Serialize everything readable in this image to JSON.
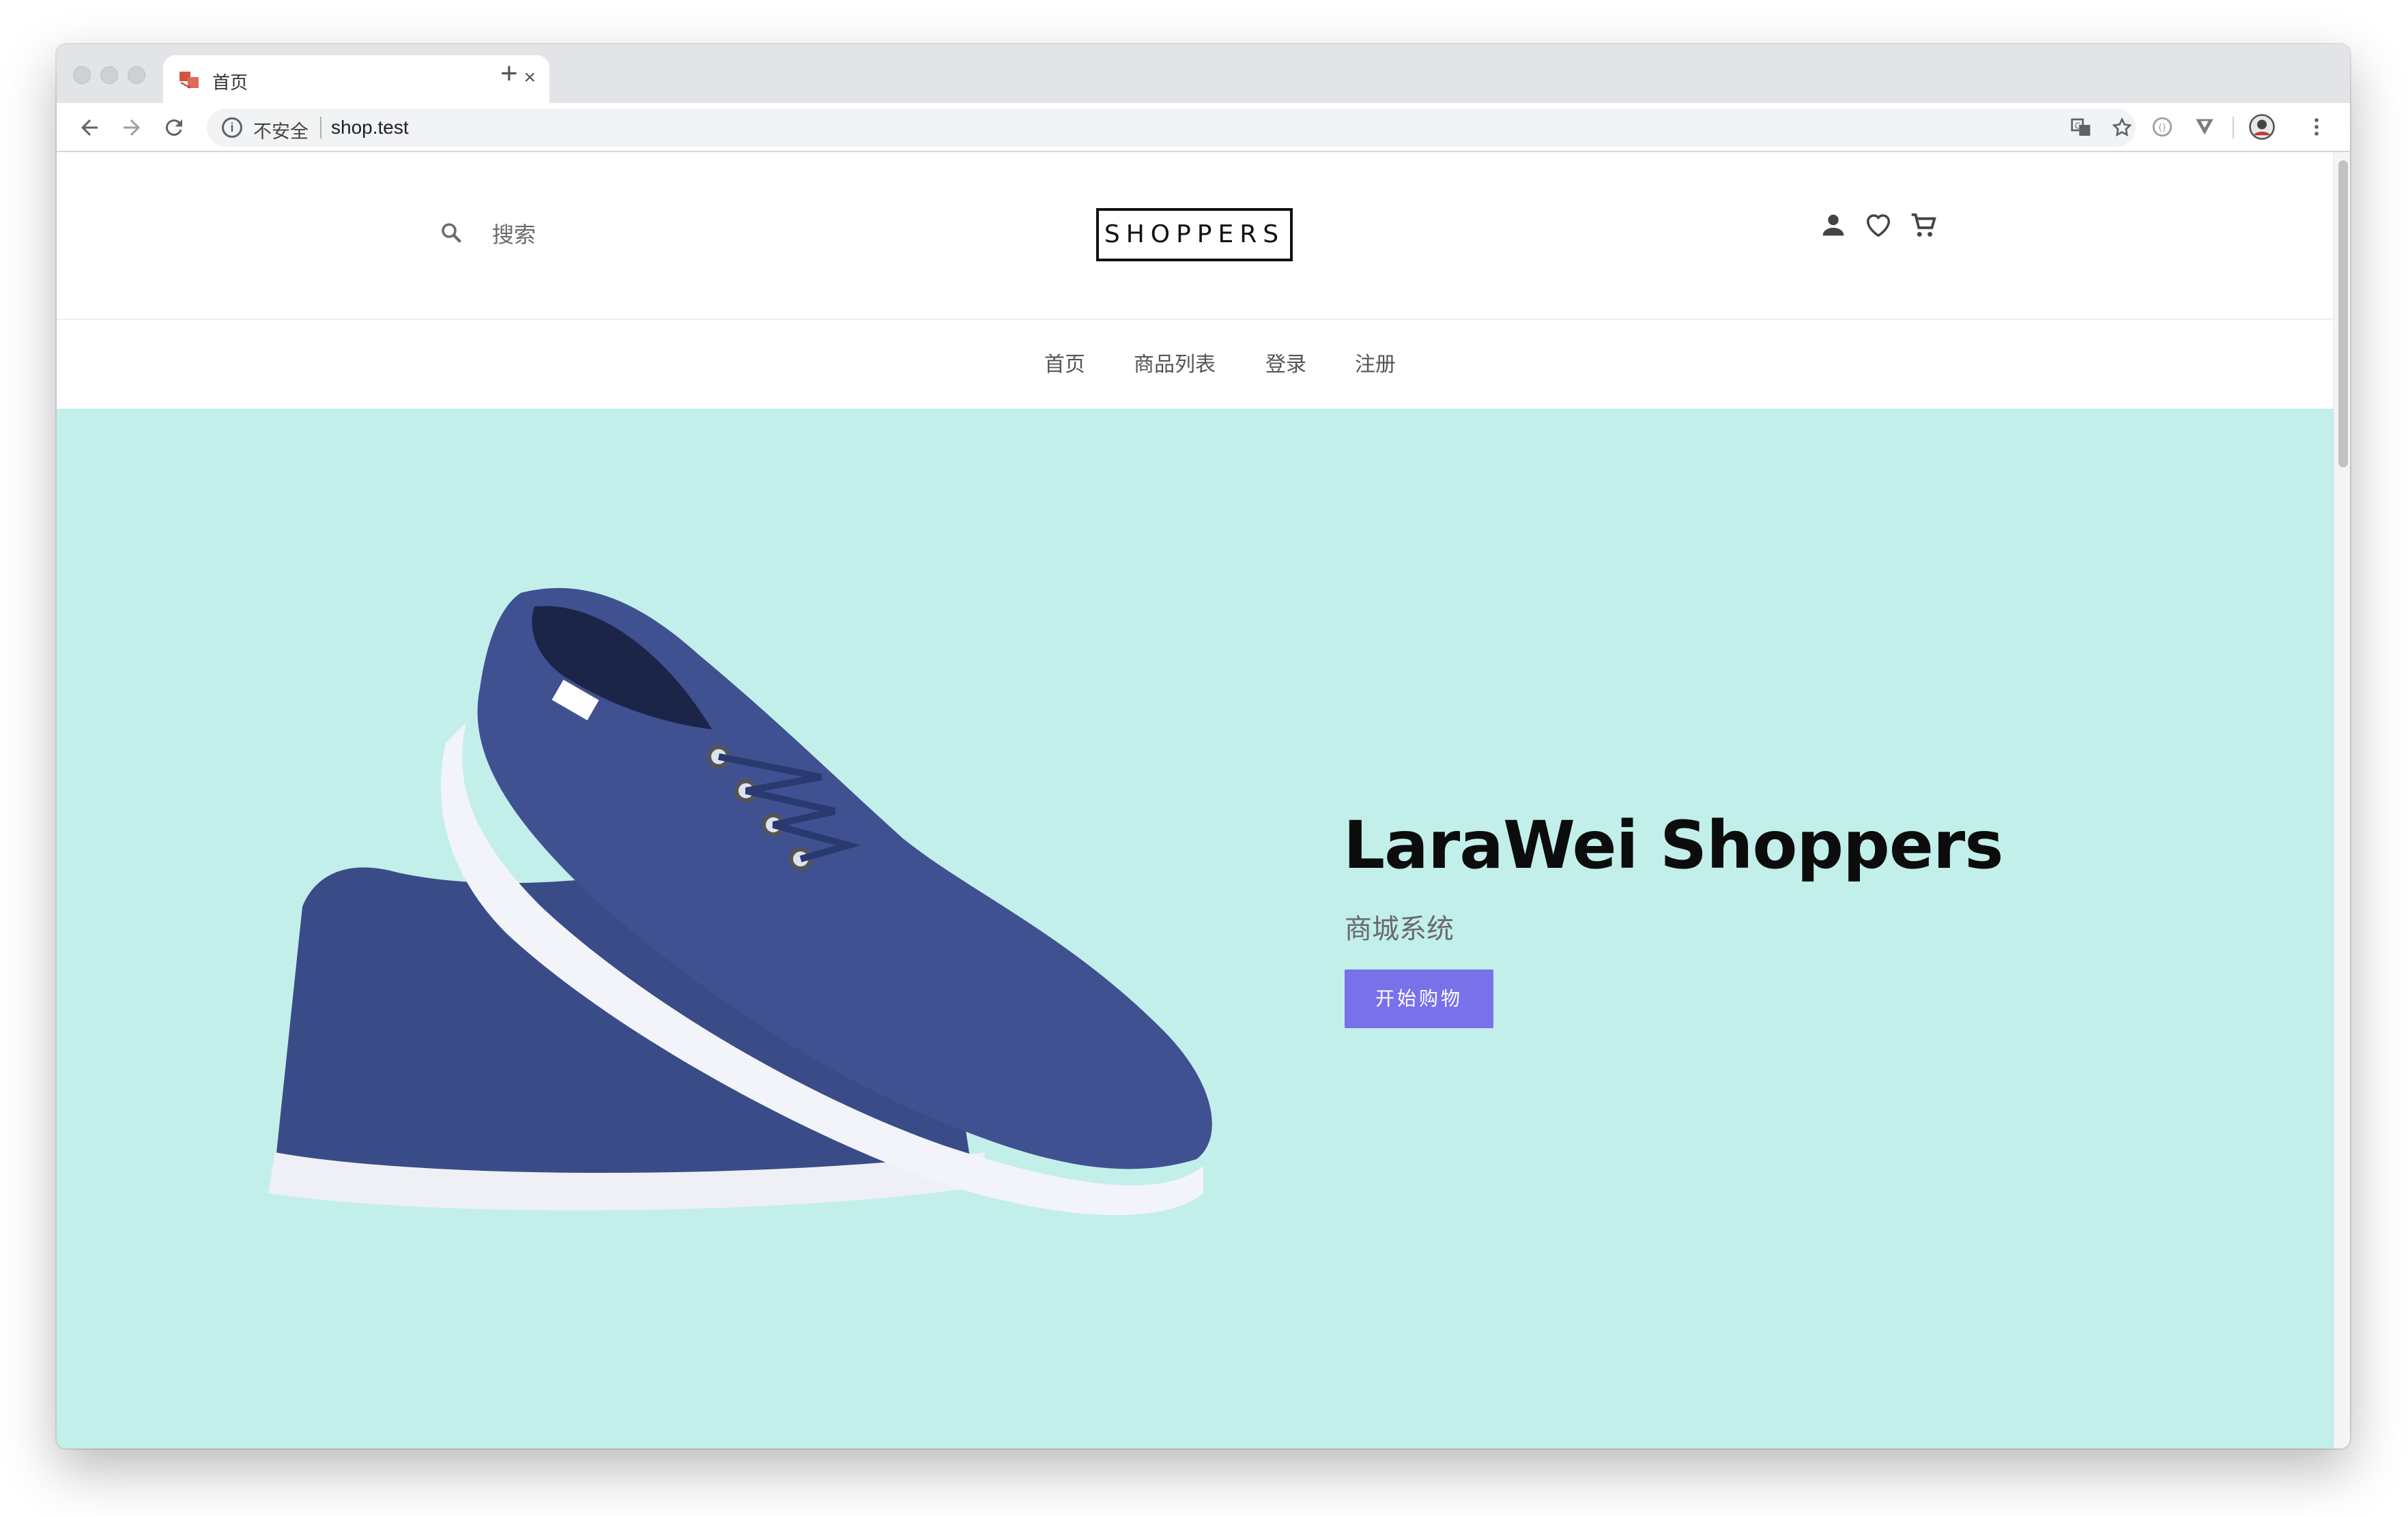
{
  "browser": {
    "tab": {
      "title": "首页",
      "close": "×"
    },
    "new_tab": "+",
    "address": {
      "security_label": "不安全",
      "url": "shop.test"
    }
  },
  "site": {
    "search_label": "搜索",
    "logo": "SHOPPERS",
    "nav": [
      "首页",
      "商品列表",
      "登录",
      "注册"
    ]
  },
  "hero": {
    "title": "LaraWei Shoppers",
    "subtitle": "商城系统",
    "cta": "开始购物",
    "background_color": "#c2efea",
    "button_color": "#7971ea"
  },
  "icons": [
    "back-icon",
    "forward-icon",
    "reload-icon",
    "info-icon",
    "translate-icon",
    "star-icon",
    "extension-icon",
    "vivaldi-icon",
    "profile-icon",
    "menu-icon",
    "search-icon",
    "user-icon",
    "heart-icon",
    "cart-icon"
  ]
}
